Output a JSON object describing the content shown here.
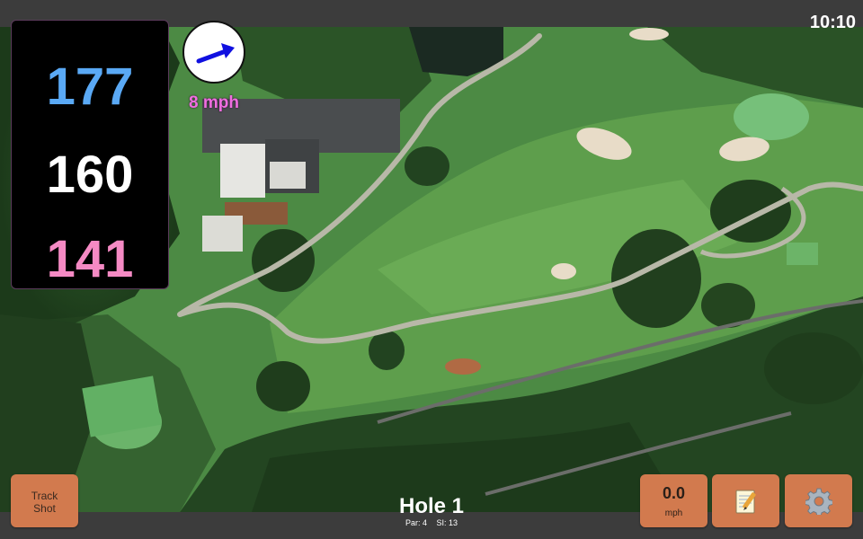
{
  "status": {
    "time": "10:10"
  },
  "distances": {
    "back": "177",
    "middle": "160",
    "front": "141"
  },
  "wind": {
    "speed_label": "8 mph",
    "icon": "arrow-right-icon",
    "color": "#1010e0"
  },
  "controls": {
    "track_shot": {
      "line1": "Track",
      "line2": "Shot"
    },
    "speed": {
      "value": "0.0",
      "unit": "mph"
    },
    "notes_icon": "notepad-icon",
    "settings_icon": "gear-icon"
  },
  "hole": {
    "title": "Hole 1",
    "par_label": "Par: 4",
    "si_label": "SI: 13"
  },
  "colors": {
    "back_distance": "#5aa9f5",
    "middle_distance": "#ffffff",
    "front_distance": "#f58ac4",
    "wind_text": "#f06ee0",
    "button": "#d27a4e"
  }
}
